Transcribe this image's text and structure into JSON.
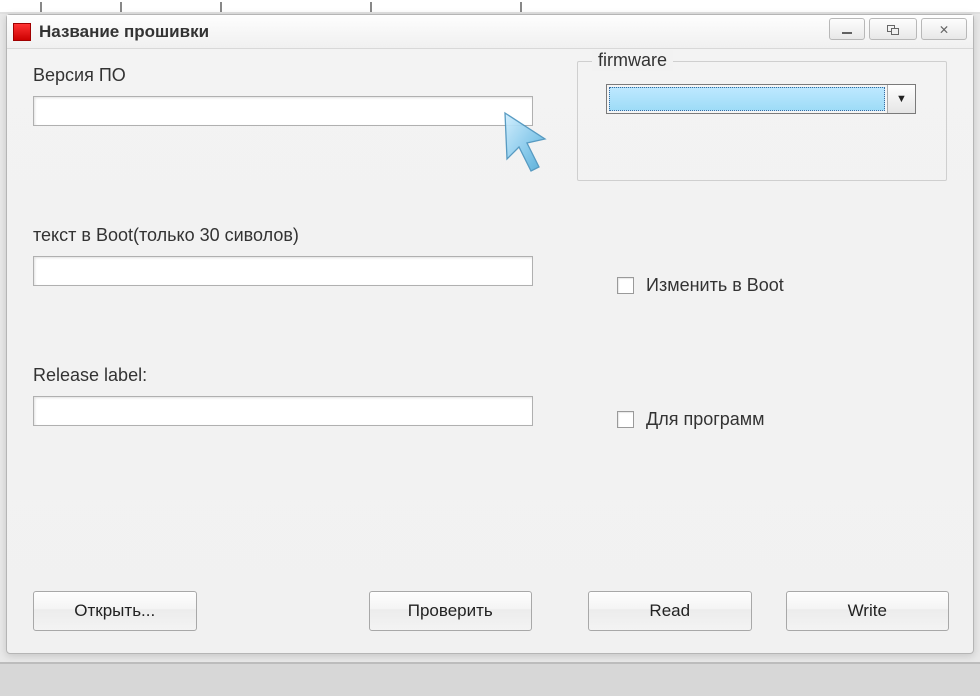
{
  "window": {
    "title": "Название прошивки"
  },
  "labels": {
    "version": "Версия ПО",
    "boot_text": "текст в Boot(только 30 сиволов)",
    "release": "Release label:",
    "firmware_group": "firmware",
    "change_boot": "Изменить в Boot",
    "for_program": "Для программ"
  },
  "fields": {
    "version_value": "",
    "boot_value": "",
    "release_value": "",
    "firmware_selected": ""
  },
  "buttons": {
    "open": "Открыть...",
    "check": "Проверить",
    "read": "Read",
    "write": "Write"
  }
}
